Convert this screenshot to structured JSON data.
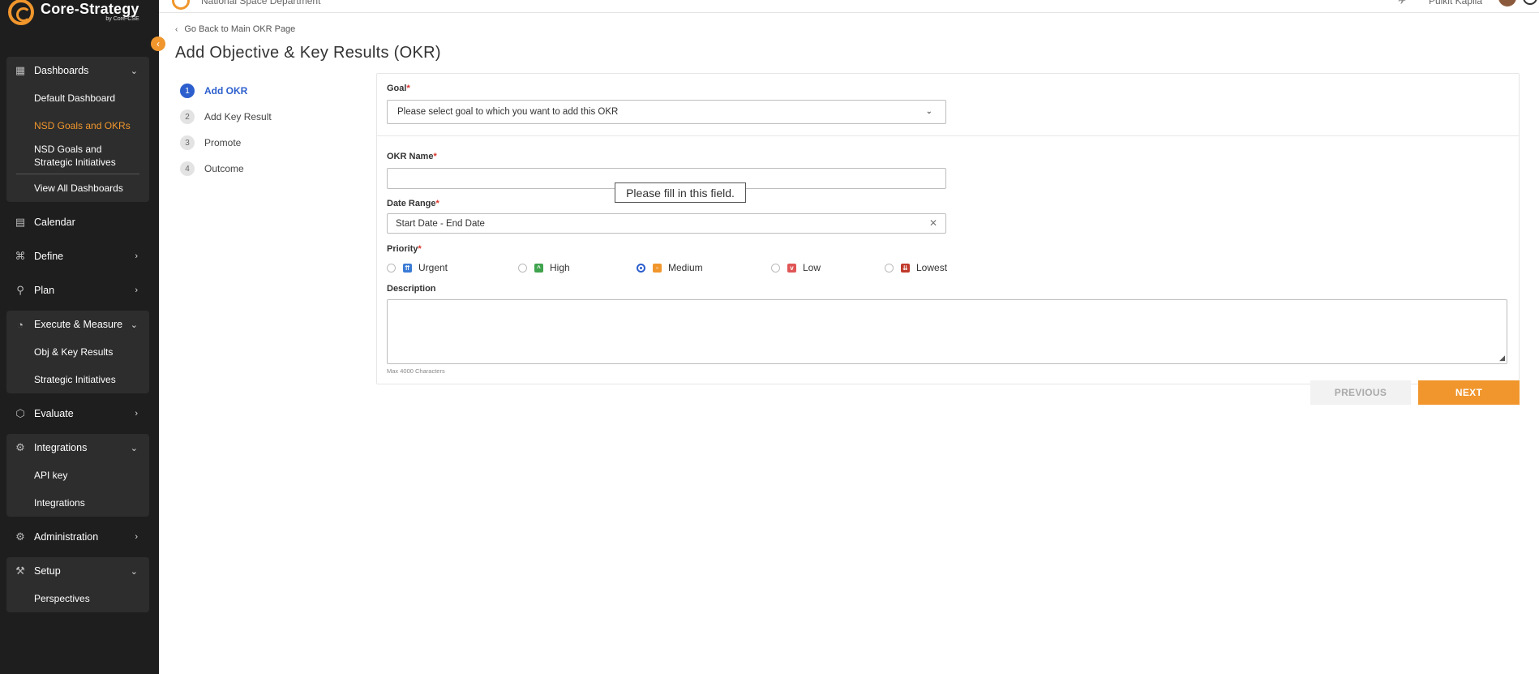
{
  "brand": {
    "name": "Core-Strategy",
    "sub": "by Core-CSE"
  },
  "topbar": {
    "org": "National Space Department",
    "user": "Pulkit Kapila"
  },
  "sidebar": {
    "dashboards": {
      "label": "Dashboards",
      "items": [
        "Default Dashboard",
        "NSD Goals and OKRs",
        "NSD Goals and Strategic Initiatives",
        "View All Dashboards"
      ]
    },
    "calendar": "Calendar",
    "define": "Define",
    "plan": "Plan",
    "execute": {
      "label": "Execute & Measure",
      "items": [
        "Obj & Key Results",
        "Strategic Initiatives"
      ]
    },
    "evaluate": "Evaluate",
    "integrations": {
      "label": "Integrations",
      "items": [
        "API key",
        "Integrations"
      ]
    },
    "administration": "Administration",
    "setup": {
      "label": "Setup",
      "items": [
        "Perspectives"
      ]
    }
  },
  "main": {
    "back_link": "Go Back to Main OKR Page",
    "title": "Add Objective & Key Results (OKR)",
    "steps": [
      {
        "num": "1",
        "label": "Add OKR"
      },
      {
        "num": "2",
        "label": "Add Key Result"
      },
      {
        "num": "3",
        "label": "Promote"
      },
      {
        "num": "4",
        "label": "Outcome"
      }
    ]
  },
  "form": {
    "goal_label": "Goal",
    "goal_placeholder": "Please select goal to which you want to add this OKR",
    "okr_name_label": "OKR Name",
    "okr_name_value": "",
    "tooltip": "Please fill in this field.",
    "date_label": "Date Range",
    "date_placeholder": "Start Date - End Date",
    "priority_label": "Priority",
    "priorities": [
      "Urgent",
      "High",
      "Medium",
      "Low",
      "Lowest"
    ],
    "priority_selected": "Medium",
    "description_label": "Description",
    "description_value": "",
    "description_hint": "Max 4000 Characters",
    "required_mark": "*"
  },
  "buttons": {
    "previous": "PREVIOUS",
    "next": "NEXT"
  },
  "colors": {
    "accent": "#f0962c",
    "primary": "#2c5fcd",
    "sidebar_bg": "#1e1e1e",
    "urgent": "#3a7bd5",
    "high": "#3fa34d",
    "medium": "#f0962c",
    "low": "#e05555",
    "lowest": "#c0392b"
  }
}
